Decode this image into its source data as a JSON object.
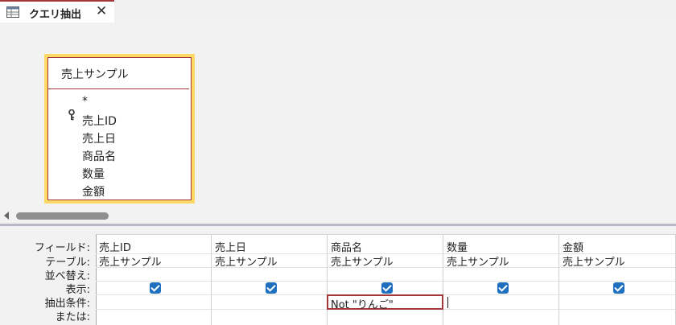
{
  "tab": {
    "title": "クエリ抽出",
    "close": "✕",
    "icon": "query-icon"
  },
  "table": {
    "title": "売上サンプル",
    "fields": [
      "*",
      "売上ID",
      "売上日",
      "商品名",
      "数量",
      "金額"
    ],
    "primary_key": "売上ID"
  },
  "grid": {
    "row_labels": [
      "フィールド:",
      "テーブル:",
      "並べ替え:",
      "表示:",
      "抽出条件:",
      "または:"
    ],
    "columns": [
      {
        "field": "売上ID",
        "table": "売上サンプル",
        "show": true,
        "criteria": ""
      },
      {
        "field": "売上日",
        "table": "売上サンプル",
        "show": true,
        "criteria": ""
      },
      {
        "field": "商品名",
        "table": "売上サンプル",
        "show": true,
        "criteria": "Not \"りんご\""
      },
      {
        "field": "数量",
        "table": "売上サンプル",
        "show": true,
        "criteria": ""
      },
      {
        "field": "金額",
        "table": "売上サンプル",
        "show": true,
        "criteria": ""
      }
    ]
  },
  "colors": {
    "accent": "#a4373a",
    "table_highlight": "#ffd966",
    "checkbox": "#1e6fbf"
  }
}
